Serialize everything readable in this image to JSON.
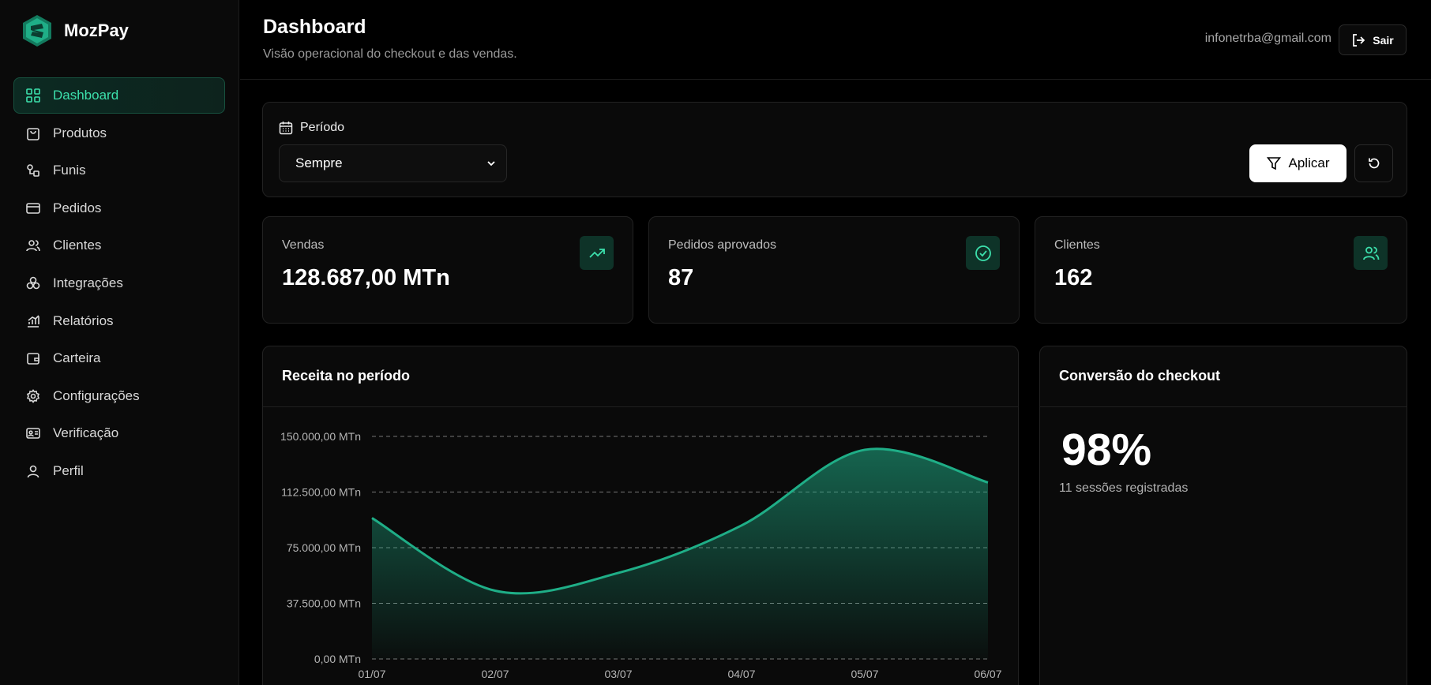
{
  "brand": {
    "name": "MozPay"
  },
  "sidebar": {
    "items": [
      {
        "label": "Dashboard",
        "icon": "grid-icon"
      },
      {
        "label": "Produtos",
        "icon": "shopping-bag-icon"
      },
      {
        "label": "Funis",
        "icon": "funnel-flow-icon"
      },
      {
        "label": "Pedidos",
        "icon": "credit-card-icon"
      },
      {
        "label": "Clientes",
        "icon": "users-icon"
      },
      {
        "label": "Integrações",
        "icon": "integrations-icon"
      },
      {
        "label": "Relatórios",
        "icon": "chart-bars-icon"
      },
      {
        "label": "Carteira",
        "icon": "wallet-icon"
      },
      {
        "label": "Configurações",
        "icon": "gear-icon"
      },
      {
        "label": "Verificação",
        "icon": "id-card-icon"
      },
      {
        "label": "Perfil",
        "icon": "user-icon"
      }
    ],
    "active_index": 0
  },
  "header": {
    "title": "Dashboard",
    "subtitle": "Visão operacional do checkout e das vendas.",
    "user_email": "infonetrba@gmail.com",
    "logout_label": "Sair"
  },
  "filter": {
    "period_label": "Período",
    "period_value": "Sempre",
    "apply_label": "Aplicar"
  },
  "stats": [
    {
      "label": "Vendas",
      "value": "128.687,00 MTn",
      "icon": "trending-up-icon"
    },
    {
      "label": "Pedidos aprovados",
      "value": "87",
      "icon": "check-circle-icon"
    },
    {
      "label": "Clientes",
      "value": "162",
      "icon": "users-icon"
    }
  ],
  "revenue_panel": {
    "title": "Receita no período"
  },
  "conversion_panel": {
    "title": "Conversão do checkout",
    "value": "98%",
    "sessions": "11 sessões registradas"
  },
  "colors": {
    "accent": "#1fae87",
    "accent_text": "#3ce0ac",
    "background": "#000000",
    "panel": "#0a0a0a"
  },
  "chart_data": {
    "type": "area",
    "x": [
      "01/07",
      "02/07",
      "03/07",
      "04/07",
      "05/07",
      "06/07"
    ],
    "values": [
      95000,
      46000,
      58000,
      90000,
      141000,
      119000
    ],
    "yticks": [
      "0,00 MTn",
      "37.500,00 MTn",
      "75.000,00 MTn",
      "112.500,00 MTn",
      "150.000,00 MTn"
    ],
    "ylim": [
      0,
      150000
    ],
    "grid": true,
    "title": "Receita no período"
  }
}
